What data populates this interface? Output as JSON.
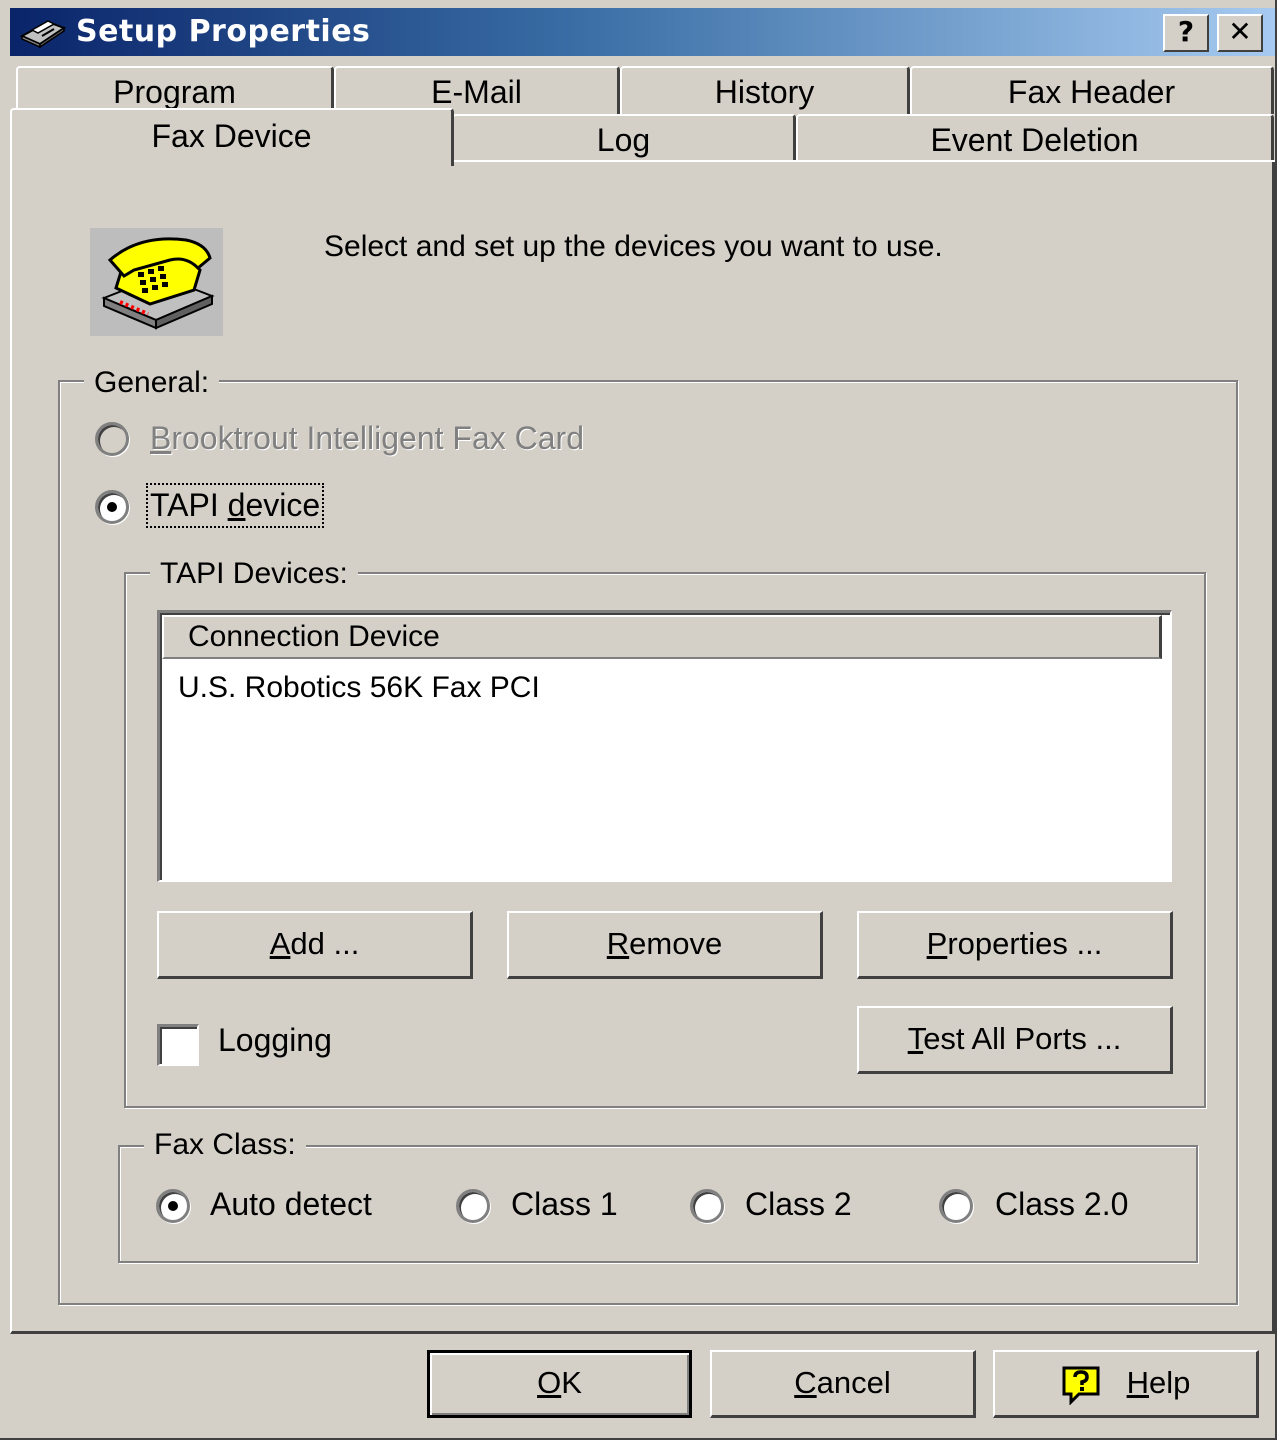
{
  "window": {
    "title": "Setup Properties",
    "help_button": "?",
    "close_button": "✕",
    "title_icon": "fax-machine-icon"
  },
  "tabs_back_row": [
    {
      "label": "Program"
    },
    {
      "label": "E-Mail"
    },
    {
      "label": "History"
    },
    {
      "label": "Fax Header"
    }
  ],
  "tabs_front_row": [
    {
      "label": "Fax Device",
      "selected": true
    },
    {
      "label": "Log"
    },
    {
      "label": "Event Deletion"
    }
  ],
  "intro": {
    "icon": "telephone-icon",
    "text": "Select and set up the devices you want to use."
  },
  "general": {
    "legend": "General:",
    "options": [
      {
        "label": "Brooktrout Intelligent Fax Card",
        "mnemonic": "B",
        "rest": "rooktrout Intelligent Fax Card",
        "enabled": false,
        "selected": false
      },
      {
        "label": "TAPI device",
        "prefix": "TAPI ",
        "mnemonic": "d",
        "rest": "evice",
        "enabled": true,
        "selected": true
      }
    ]
  },
  "tapi": {
    "legend": "TAPI Devices:",
    "column_header": "Connection Device",
    "rows": [
      "U.S. Robotics 56K Fax PCI"
    ],
    "buttons": {
      "add": {
        "label": "Add ...",
        "mnemonic": "A",
        "rest": "dd ..."
      },
      "remove": {
        "label": "Remove",
        "mnemonic": "R",
        "rest": "emove"
      },
      "properties": {
        "label": "Properties ...",
        "mnemonic": "P",
        "rest": "roperties ..."
      },
      "test_all_ports": {
        "label": "Test All Ports ...",
        "mnemonic": "T",
        "rest": "est All Ports ..."
      }
    },
    "logging": {
      "label": "Logging",
      "checked": false
    }
  },
  "fax_class": {
    "legend": "Fax Class:",
    "options": [
      {
        "label": "Auto detect",
        "selected": true
      },
      {
        "label": "Class 1",
        "selected": false
      },
      {
        "label": "Class 2",
        "selected": false
      },
      {
        "label": "Class 2.0",
        "selected": false
      }
    ]
  },
  "footer": {
    "ok": {
      "label": "OK",
      "mnemonic": "O",
      "rest": "K"
    },
    "cancel": {
      "label": "Cancel",
      "mnemonic": "C",
      "rest": "ancel"
    },
    "help": {
      "label": "Help",
      "mnemonic": "H",
      "rest": "elp",
      "icon": "help-question-icon"
    }
  },
  "colors": {
    "face": "#d4d0c8",
    "title_start": "#0a246a",
    "title_end": "#a6caf0",
    "phone_yellow": "#ffff00"
  }
}
